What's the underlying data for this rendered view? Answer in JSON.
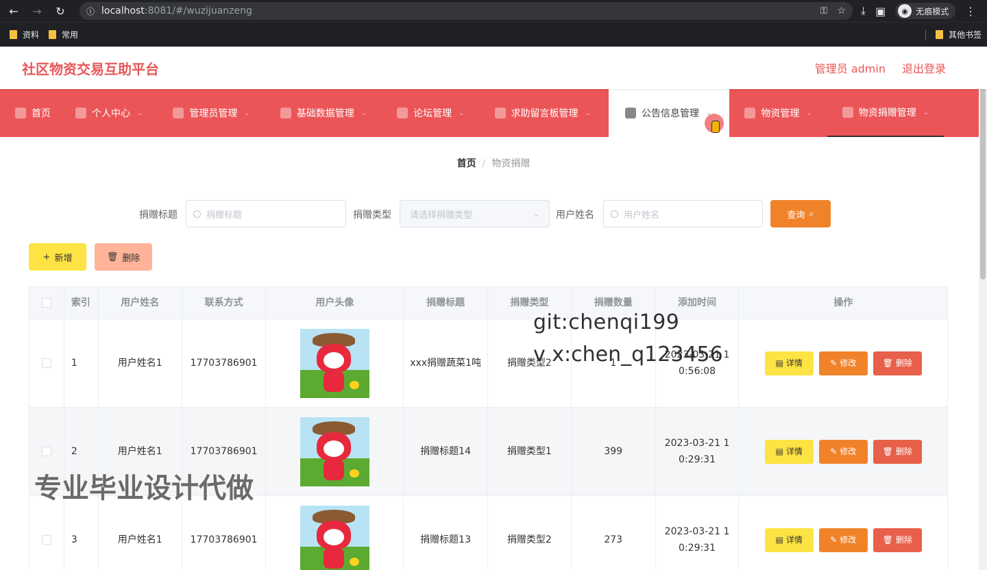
{
  "browser": {
    "url_host": "localhost",
    "url_path": ":8081/#/wuzijuanzeng",
    "incognito_label": "无痕模式",
    "bookmarks": [
      "资料",
      "常用"
    ],
    "other_bookmarks": "其他书签"
  },
  "header": {
    "title": "社区物资交易互助平台",
    "user": "管理员 admin",
    "logout": "退出登录"
  },
  "menu": [
    {
      "label": "首页"
    },
    {
      "label": "个人中心"
    },
    {
      "label": "管理员管理"
    },
    {
      "label": "基础数据管理"
    },
    {
      "label": "论坛管理"
    },
    {
      "label": "求助留言板管理"
    },
    {
      "label": "公告信息管理"
    },
    {
      "label": "物资管理"
    },
    {
      "label": "物资捐赠管理"
    }
  ],
  "breadcrumb": {
    "home": "首页",
    "current": "物资捐赠"
  },
  "search": {
    "title_label": "捐赠标题",
    "title_placeholder": "捐赠标题",
    "type_label": "捐赠类型",
    "type_placeholder": "请选择捐赠类型",
    "user_label": "用户姓名",
    "user_placeholder": "用户姓名",
    "query": "查询"
  },
  "actions": {
    "add": "新增",
    "delete": "删除"
  },
  "table": {
    "headers": [
      "索引",
      "用户姓名",
      "联系方式",
      "用户头像",
      "捐赠标题",
      "捐赠类型",
      "捐赠数量",
      "添加时间",
      "操作"
    ],
    "rows": [
      {
        "idx": "1",
        "name": "用户姓名1",
        "phone": "17703786901",
        "title": "xxx捐赠蔬菜1吨",
        "type": "捐赠类型2",
        "qty": "1",
        "time1": "2023-03-21 1",
        "time2": "0:56:08"
      },
      {
        "idx": "2",
        "name": "用户姓名1",
        "phone": "17703786901",
        "title": "捐赠标题14",
        "type": "捐赠类型1",
        "qty": "399",
        "time1": "2023-03-21 1",
        "time2": "0:29:31"
      },
      {
        "idx": "3",
        "name": "用户姓名1",
        "phone": "17703786901",
        "title": "捐赠标题13",
        "type": "捐赠类型2",
        "qty": "273",
        "time1": "2023-03-21 1",
        "time2": "0:29:31"
      }
    ],
    "ops": {
      "detail": "详情",
      "edit": "修改",
      "delete": "删除"
    }
  },
  "watermarks": {
    "line1": "git:chenqi199",
    "line2": "v x:chen_q123456",
    "line3": "专业毕业设计代做"
  }
}
